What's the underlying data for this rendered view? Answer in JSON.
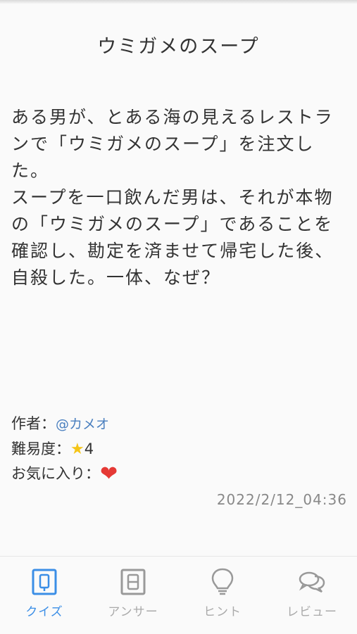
{
  "quiz": {
    "title": "ウミガメのスープ",
    "question": "ある男が、とある海の見えるレストランで「ウミガメのスープ」を注文した。\nスープを一口飲んだ男は、それが本物の「ウミガメのスープ」であることを確認し、勘定を済ませて帰宅した後、自殺した。一体、なぜ？"
  },
  "meta": {
    "author_label": "作者：",
    "author_name": "@カメオ",
    "difficulty_label": "難易度：",
    "difficulty_star": "★",
    "difficulty_value": "4",
    "favorite_label": "お気に入り：",
    "favorite_icon": "❤"
  },
  "timestamp": "2022/2/12_04:36",
  "nav": {
    "active_color": "#3b8ee6",
    "inactive_color": "#aaaaaa",
    "items": [
      {
        "label": "クイズ",
        "icon": "quiz-q-icon",
        "active": true
      },
      {
        "label": "アンサー",
        "icon": "answer-a-icon",
        "active": false
      },
      {
        "label": "ヒント",
        "icon": "hint-lightbulb-icon",
        "active": false
      },
      {
        "label": "レビュー",
        "icon": "review-chat-icon",
        "active": false
      }
    ]
  }
}
